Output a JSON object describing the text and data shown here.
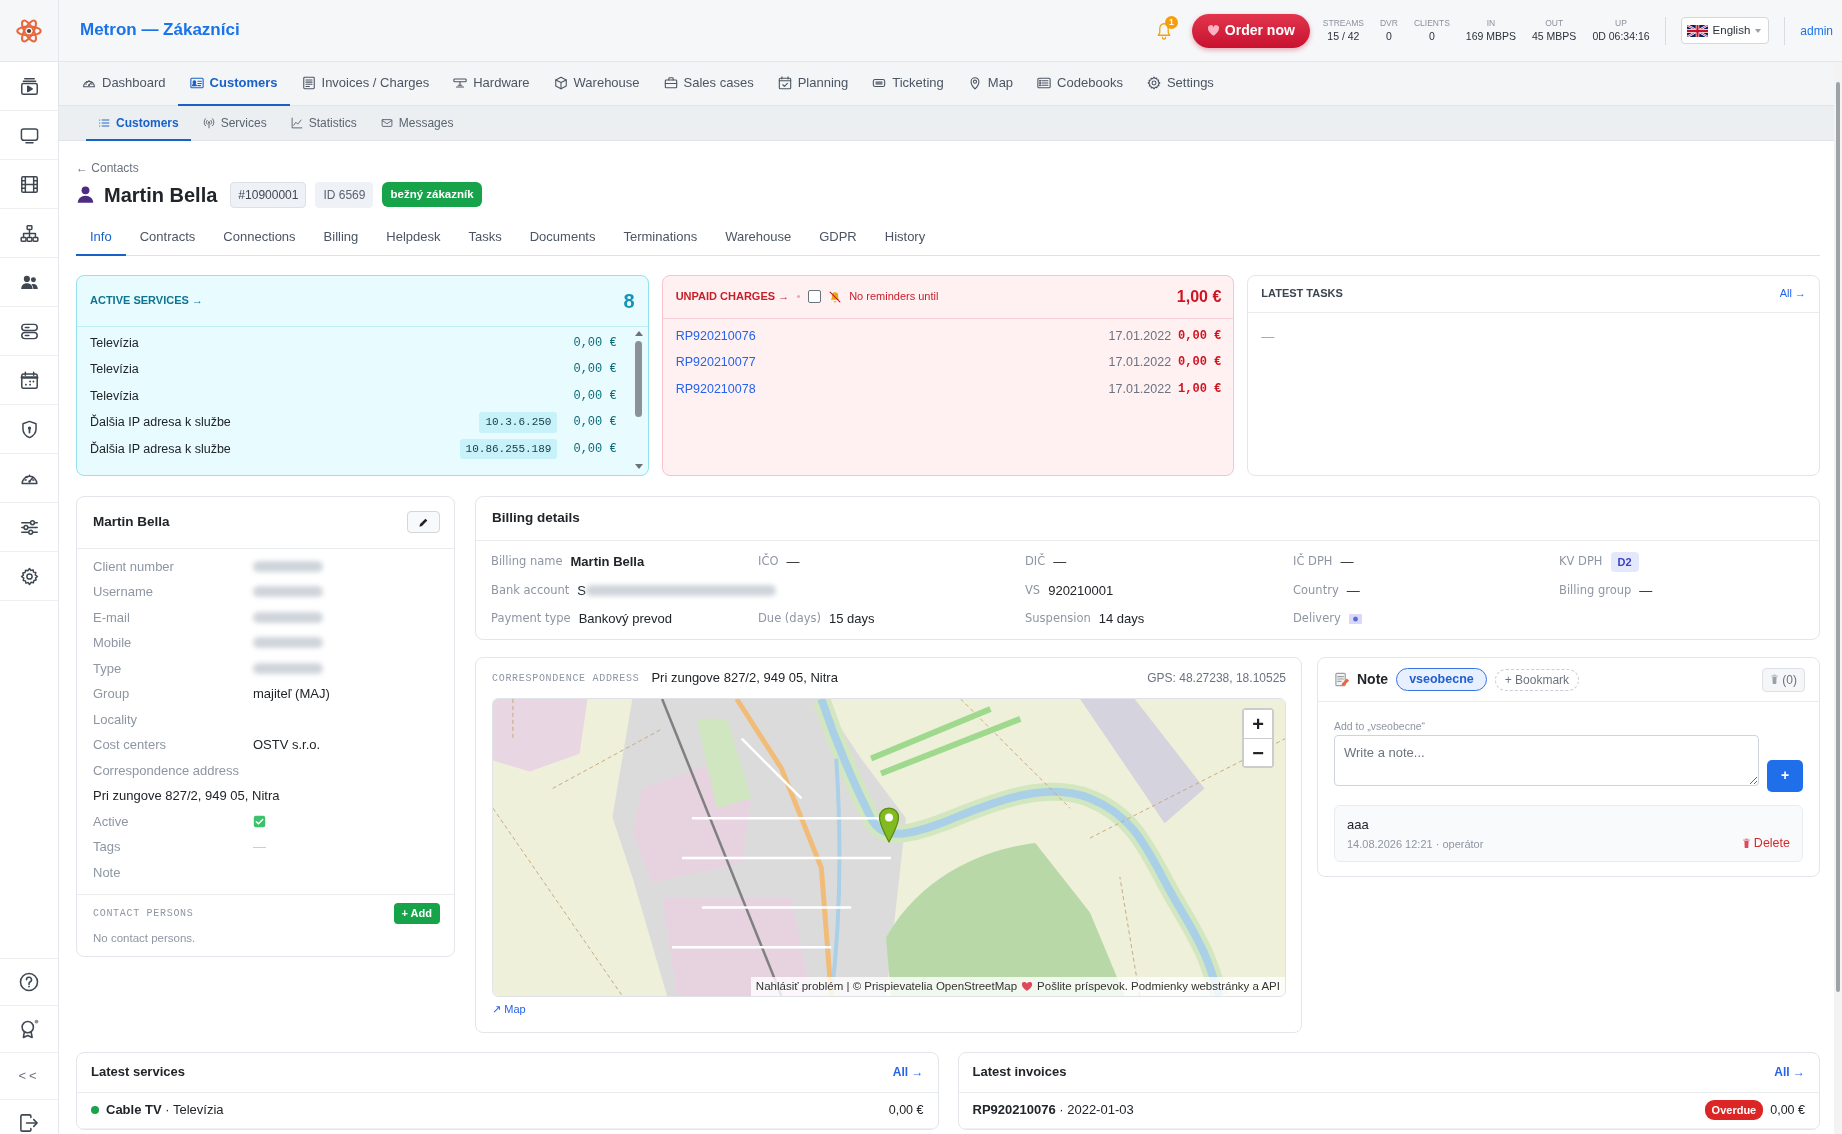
{
  "app": {
    "title": "Metron — Zákazníci"
  },
  "sidebar": {
    "collapse": "<<"
  },
  "topbar": {
    "notifications": "1",
    "order_button": "Order now",
    "stats": [
      {
        "label": "STREAMS",
        "value": "15 / 42"
      },
      {
        "label": "DVR",
        "value": "0"
      },
      {
        "label": "CLIENTS",
        "value": "0"
      },
      {
        "label": "IN",
        "value": "169 MBPS"
      },
      {
        "label": "OUT",
        "value": "45 MBPS"
      },
      {
        "label": "UP",
        "value": "0D 06:34:16"
      }
    ],
    "language": "English",
    "user": "admin"
  },
  "main_nav": [
    {
      "label": "Dashboard",
      "selected": false
    },
    {
      "label": "Customers",
      "selected": true
    },
    {
      "label": "Invoices / Charges",
      "selected": false
    },
    {
      "label": "Hardware",
      "selected": false
    },
    {
      "label": "Warehouse",
      "selected": false
    },
    {
      "label": "Sales cases",
      "selected": false
    },
    {
      "label": "Planning",
      "selected": false
    },
    {
      "label": "Ticketing",
      "selected": false
    },
    {
      "label": "Map",
      "selected": false
    },
    {
      "label": "Codebooks",
      "selected": false
    },
    {
      "label": "Settings",
      "selected": false
    }
  ],
  "sub_nav": [
    {
      "label": "Customers",
      "selected": true
    },
    {
      "label": "Services",
      "selected": false
    },
    {
      "label": "Statistics",
      "selected": false
    },
    {
      "label": "Messages",
      "selected": false
    }
  ],
  "breadcrumb": "← Contacts",
  "customer": {
    "name": "Martin Bella",
    "number": "#10900001",
    "id": "ID 6569",
    "type": "bežný zákazník"
  },
  "tabs": [
    {
      "label": "Info",
      "selected": true
    },
    {
      "label": "Contracts",
      "selected": false
    },
    {
      "label": "Connections",
      "selected": false
    },
    {
      "label": "Billing",
      "selected": false
    },
    {
      "label": "Helpdesk",
      "selected": false
    },
    {
      "label": "Tasks",
      "selected": false
    },
    {
      "label": "Documents",
      "selected": false
    },
    {
      "label": "Terminations",
      "selected": false
    },
    {
      "label": "Warehouse",
      "selected": false
    },
    {
      "label": "GDPR",
      "selected": false
    },
    {
      "label": "History",
      "selected": false
    }
  ],
  "active_services": {
    "title": "ACTIVE SERVICES →",
    "count": "8",
    "rows": [
      {
        "name": "Televízia",
        "amount": "0,00 €"
      },
      {
        "name": "Televízia",
        "amount": "0,00 €"
      },
      {
        "name": "Televízia",
        "amount": "0,00 €"
      },
      {
        "name": "Ďalšia IP adresa k službe",
        "ip": "10.3.6.250",
        "amount": "0,00 €"
      },
      {
        "name": "Ďalšia IP adresa k službe",
        "ip": "10.86.255.189",
        "amount": "0,00 €"
      }
    ]
  },
  "unpaid_charges": {
    "title": "UNPAID CHARGES →",
    "reminder": {
      "checked": false,
      "label": "No reminders until"
    },
    "total": "1,00 €",
    "rows": [
      {
        "number": "RP920210076",
        "date": "17.01.2022",
        "amount": "0,00 €"
      },
      {
        "number": "RP920210077",
        "date": "17.01.2022",
        "amount": "0,00 €"
      },
      {
        "number": "RP920210078",
        "date": "17.01.2022",
        "amount": "1,00 €"
      }
    ]
  },
  "latest_tasks": {
    "title": "LATEST TASKS",
    "link": "All →",
    "empty": "—"
  },
  "profile": {
    "title": "Martin Bella",
    "fields": [
      {
        "kind": "masked",
        "label": "Client number"
      },
      {
        "kind": "masked",
        "label": "Username"
      },
      {
        "kind": "masked",
        "label": "E-mail"
      },
      {
        "kind": "masked",
        "label": "Mobile"
      },
      {
        "kind": "masked",
        "label": "Type"
      },
      {
        "kind": "text",
        "label": "Group",
        "value": "majiteľ (MAJ)"
      },
      {
        "kind": "text",
        "label": "Locality"
      },
      {
        "kind": "text",
        "label": "Cost centers",
        "value": "OSTV s.r.o."
      },
      {
        "kind": "stacked",
        "label": "Correspondence address",
        "value": "Pri zungove 827/2, 949 05, Nitra"
      },
      {
        "kind": "check",
        "label": "Active",
        "checked": true
      },
      {
        "kind": "muted",
        "label": "Tags",
        "value": "—"
      },
      {
        "kind": "text",
        "label": "Note"
      }
    ],
    "contacts": {
      "title": "CONTACT PERSONS",
      "add": "+ Add",
      "empty": "No contact persons."
    }
  },
  "billing": {
    "title": "Billing details",
    "fields": [
      {
        "kind": "strong",
        "label": "Billing name",
        "value": "Martin Bella"
      },
      {
        "kind": "text",
        "label": "IČO",
        "value": "—"
      },
      {
        "kind": "text",
        "label": "DIČ",
        "value": "—"
      },
      {
        "kind": "text",
        "label": "IČ DPH",
        "value": "—"
      },
      {
        "kind": "badge",
        "label": "KV DPH",
        "value": "D2"
      },
      {
        "kind": "masked",
        "label": "Bank account",
        "value": "S"
      },
      {
        "kind": "text",
        "label": "VS",
        "value": "920210001"
      },
      {
        "kind": "text",
        "label": "Country",
        "value": "—"
      },
      {
        "kind": "text",
        "label": "Billing group",
        "value": "—"
      },
      {
        "kind": "text",
        "label": "Payment type",
        "value": "Bankový prevod"
      },
      {
        "kind": "text",
        "label": "Due (days)",
        "value": "15 days"
      },
      {
        "kind": "text",
        "label": "Suspension",
        "value": "14 days"
      }
    ],
    "delivery": {
      "label": "Delivery"
    }
  },
  "address": {
    "label": "CORRESPONDENCE ADDRESS",
    "value": "Pri zungove 827/2, 949 05, Nitra",
    "gps": "GPS: 48.27238, 18.10525",
    "zoom_in": "+",
    "zoom_out": "−",
    "attribution": [
      "Nahlásiť problém | © Prispievatelia OpenStreetMap",
      "Pošlite príspevok. Podmienky webstránky a API"
    ],
    "link": "↗ Map"
  },
  "note": {
    "title": "Note",
    "bookmarks": [
      {
        "label": "vseobecne",
        "selected": true
      }
    ],
    "add_bookmark": "+ Bookmark",
    "trash": "(0)",
    "add_label": "Add to „vseobecne“",
    "placeholder": "Write a note...",
    "submit": "+",
    "items": [
      {
        "text": "aaa",
        "meta": "14.08.2026 12:21 · operátor",
        "delete": "Delete"
      }
    ]
  },
  "latest_services": {
    "title": "Latest services",
    "link": "All →",
    "rows": [
      {
        "label": "**Cable TV** · Televízia",
        "amount": "0,00 €",
        "color": "#1aa34a"
      }
    ]
  },
  "latest_invoices": {
    "title": "Latest invoices",
    "link": "All →",
    "rows": [
      {
        "label": "**RP920210076** · 2022-01-03",
        "status": "Overdue",
        "amount": "0,00 €"
      }
    ]
  }
}
